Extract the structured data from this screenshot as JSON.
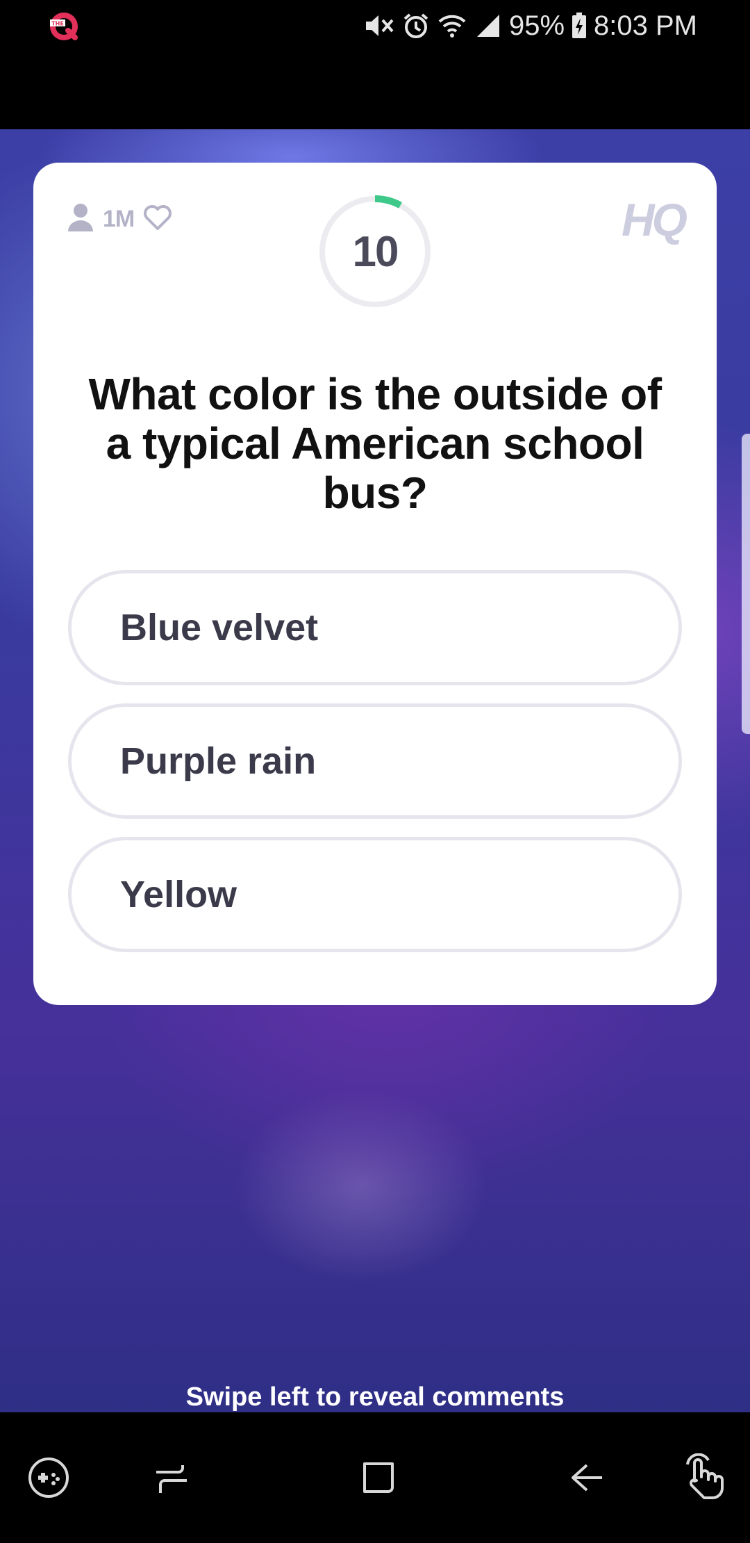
{
  "status_bar": {
    "battery": "95%",
    "time": "8:03 PM",
    "icons": [
      "hq-app-notification-icon",
      "mute-vibrate-icon",
      "alarm-icon",
      "wifi-icon",
      "signal-icon",
      "battery-charging-icon"
    ]
  },
  "card": {
    "viewer_count": "1M",
    "logo": "HQ",
    "timer": "10",
    "timer_progress": 0.08,
    "accent_color": "#3ec98b",
    "question": "What color is the outside of a typical American school bus?",
    "answers": [
      "Blue velvet",
      "Purple rain",
      "Yellow"
    ]
  },
  "swipe_hint": "Swipe left to reveal comments",
  "nav_bar": {
    "icons": [
      "game-launcher-icon",
      "recent-apps-icon",
      "home-icon",
      "back-icon",
      "gesture-icon"
    ]
  }
}
